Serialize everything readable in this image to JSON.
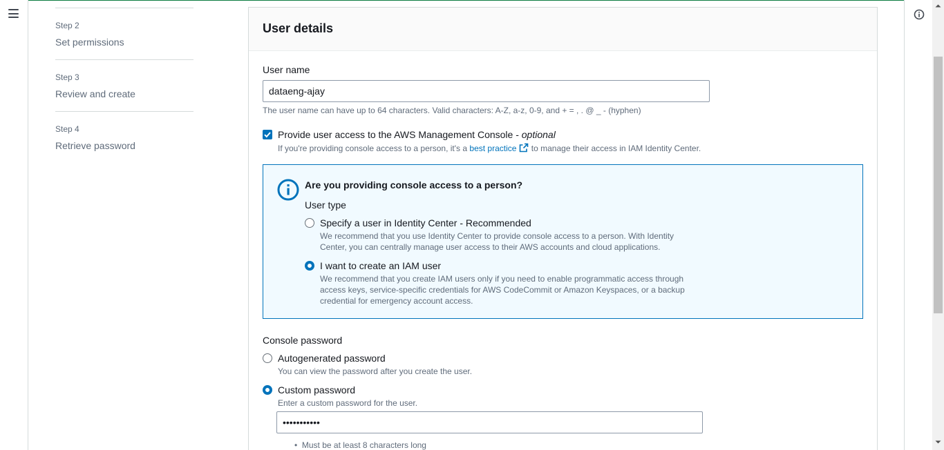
{
  "colors": {
    "accent": "#0073bb",
    "border": "#d5dbdb",
    "muted_text": "#5f6b7a",
    "alert_bg": "#f1faff"
  },
  "nav": {
    "menu_icon": "hamburger-menu-icon",
    "info_icon": "info-circle-icon"
  },
  "steps": [
    {
      "number": "Step 2",
      "title": "Set permissions"
    },
    {
      "number": "Step 3",
      "title": "Review and create"
    },
    {
      "number": "Step 4",
      "title": "Retrieve password"
    }
  ],
  "panel": {
    "title": "User details"
  },
  "user_name": {
    "label": "User name",
    "value": "dataeng-ajay",
    "constraint_hint": "The user name can have up to 64 characters. Valid characters: A-Z, a-z, 0-9, and + = , . @ _ - (hyphen)"
  },
  "console_access": {
    "checked": true,
    "label": "Provide user access to the AWS Management Console - ",
    "label_optional": "optional",
    "hint_prefix": "If you're providing console access to a person, it's a ",
    "hint_link": "best practice",
    "hint_suffix": " to manage their access in IAM Identity Center."
  },
  "alert": {
    "title": "Are you providing console access to a person?",
    "user_type_label": "User type",
    "options": [
      {
        "label": "Specify a user in Identity Center - Recommended",
        "selected": false,
        "description_line1": "We recommend that you use Identity Center to provide console access to a person. With Identity",
        "description_line2": "Center, you can centrally manage user access to their AWS accounts and cloud applications."
      },
      {
        "label": "I want to create an IAM user",
        "selected": true,
        "description_line1": "We recommend that you create IAM users only if you need to enable programmatic access through",
        "description_line2": "access keys, service-specific credentials for AWS CodeCommit or Amazon Keyspaces, or a backup",
        "description_line3": "credential for emergency account access."
      }
    ]
  },
  "console_password": {
    "label": "Console password",
    "options": [
      {
        "label": "Autogenerated password",
        "selected": false,
        "description": "You can view the password after you create the user."
      },
      {
        "label": "Custom password",
        "selected": true,
        "description": "Enter a custom password for the user."
      }
    ],
    "masked_value": "•••••••••••",
    "requirements": [
      "Must be at least 8 characters long"
    ]
  }
}
